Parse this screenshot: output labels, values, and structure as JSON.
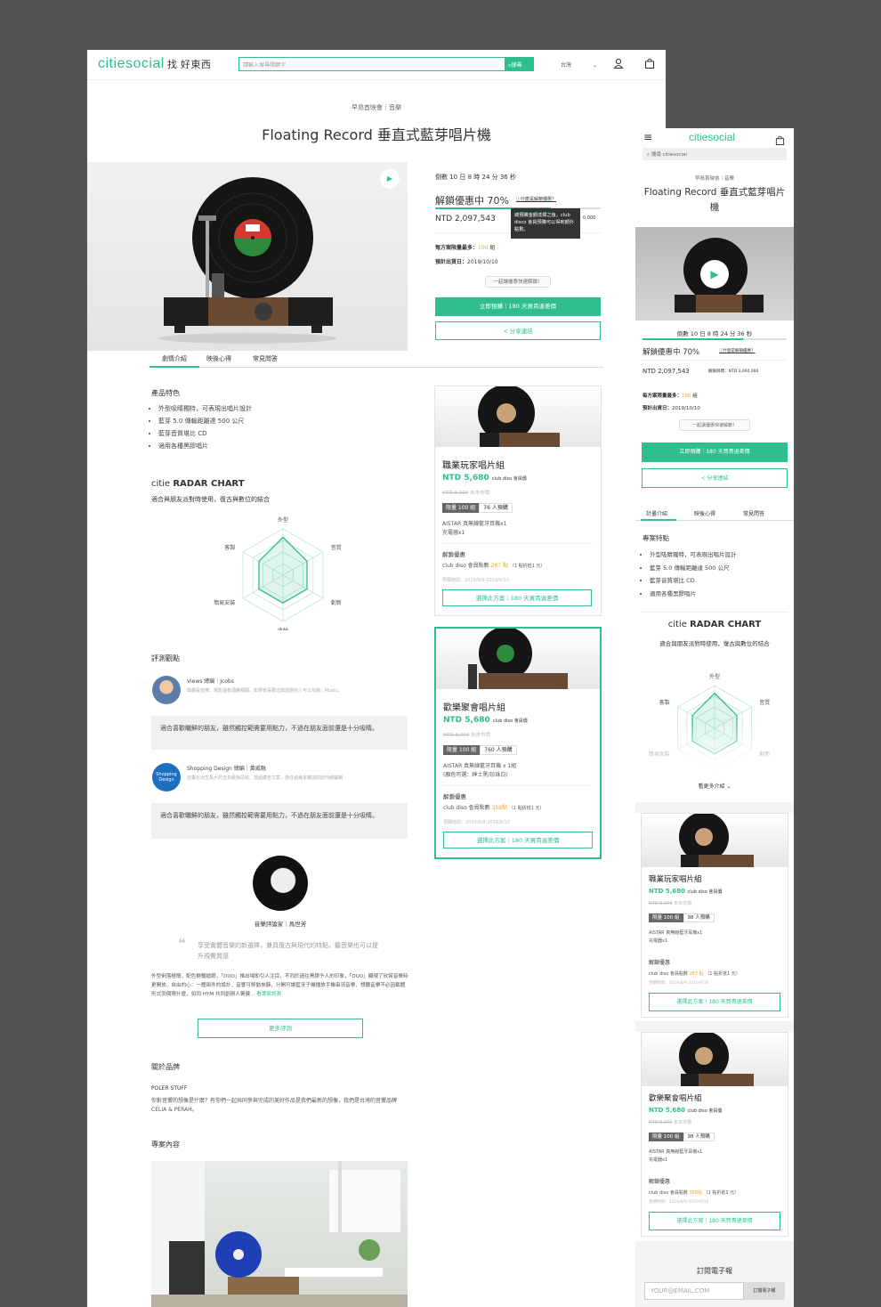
{
  "brand": {
    "name": "citiesocial",
    "slogan": "找 好東西",
    "color": "#2fbf8e"
  },
  "header": {
    "search_placeholder": "請輸入搜尋關鍵字",
    "search_button": "搜尋",
    "region": "台灣"
  },
  "project": {
    "category": "早鳥首映會｜音樂",
    "title": "Floating Record 垂直式藍芽唱片機",
    "countdown": "倒數 10 日 8 時 24 分 36 秒",
    "unlock": "解鎖優惠中 70%",
    "what_unlock": "什麼是解鎖優惠？",
    "amount": "NTD 2,097,543",
    "goal": "解鎖目標：NTD 3,000,000",
    "goal_short": "0,000",
    "tooltip": "總預購金額達標之後，club disco 會員預購可以得到額外點數。",
    "limit_label": "每方案限量最多：",
    "limit_value": "100",
    "limit_unit": "組",
    "ship_label": "預計出貨日：",
    "ship_value": "2019/10/10",
    "hint": "一起讓優惠快速解鎖！",
    "preorder_button": "立即預購｜180 天買貴退差價",
    "share_button": "分享連結",
    "progress": 0.7
  },
  "tabs": [
    "劇情介紹",
    "映後心得",
    "常見問答"
  ],
  "mobile_tabs": [
    "計畫介紹",
    "映後心得",
    "常見問答"
  ],
  "features": {
    "title": "產品特色",
    "mobile_title": "專案特點",
    "items": [
      "外型吸睛獨特，可表現出唱片設計",
      "藍芽 5.0 傳輸距離達 500 公尺",
      "藍芽音質堪比 CD",
      "適用各種黑膠唱片"
    ]
  },
  "radar": {
    "title_light": "citie",
    "title_bold": "RADAR CHART",
    "subtitle": "適合與朋友派對時使用，復古與數位的結合",
    "axes": [
      "外型",
      "音質",
      "創新",
      "收納",
      "簡易安裝",
      "客製"
    ],
    "values": [
      0.82,
      0.6,
      0.6,
      0.6,
      0.6,
      0.6
    ],
    "more": "看更多介紹"
  },
  "reviews": {
    "title": "評測觀點",
    "items": [
      {
        "name": "Views 總編｜Jcobs",
        "desc": "興趣是音樂、電影還有酒精相關，如果有喜歡這篇話題的人可以找我，Music。",
        "text": "適合喜歡曬鮮的朋友，雖然觸控範需要用點力，不過在朋友面前還是十分吸睛。"
      },
      {
        "name": "Shopping Design 總編｜黃威融",
        "desc": "在臺北出生長大的五年級後段班，當過廣告文案，擔任過幾本雜誌的創刊總編輯",
        "avatar_text": "Shopping Design",
        "text": "適合喜歡曬鮮的朋友，雖然觸控範需要用點力，不過在朋友面前還是十分吸睛。"
      }
    ]
  },
  "critic": {
    "name": "音樂評論家｜馬世芳",
    "quote": "享受實體音樂的新選擇，兼具復古與現代的特點，聽音樂也可以提升視覺質感",
    "body": "外型俐落極簡，配色鮮豔搶眼，「DUO」推出場即引人注目，不同於過往黑膠予人的印象，「DUO」顯現了欣賞音樂時更開放、自由的心：一體兩件的設計，音響可移動來靜，分開可讓藍牙子機播放手機串流音樂，想聽音樂不必因載體形式而侷限什麼，如同 HYM 共同創辦人黃健...",
    "more_link": "看專家評測",
    "more_button": "更多評測"
  },
  "brand_section": {
    "title": "關於品牌",
    "name": "POLER STUFF",
    "text": "你對音響的想像是什麼？有你們一起共同參與完成的美好作品是我們最新的想像，我們是台灣的音響品牌CELIA & PERAH。"
  },
  "content_title": "專案內容",
  "plans": [
    {
      "name": "職業玩家唱片組",
      "price": "NTD 5,680",
      "price_note": "club diso 會員價",
      "orig": "NTD 8,000",
      "orig_note": "未來市價",
      "limit": "限量 100 組",
      "sold": "76 人預購",
      "mobile_sold": "98 人預購",
      "items": [
        "AISTAR 真無線藍牙耳機x1",
        "充電器x1"
      ],
      "unlock_title": "解鎖優惠",
      "unlock_text": "club diso 會員點數",
      "points": "267 點",
      "points_note": "（1 點折抵1 元）",
      "period": "預購時間：2019/8/9-2019/9/10",
      "button": "選擇此方案｜180 天買貴退差價"
    },
    {
      "name": "歡樂聚會唱片組",
      "price": "NTD 5,680",
      "price_note": "club diso 會員價",
      "orig": "NTD 8,000",
      "orig_note": "未來市價",
      "limit": "限量 100 組",
      "sold": "760 人預購",
      "mobile_sold": "98 人預購",
      "items": [
        "AISTAR 真無線藍牙耳機 x 1組",
        "(顏色可選：紳士黑/珍珠白)"
      ],
      "mobile_items": [
        "AISTAR 真無線藍牙耳機x1",
        "充電器x1"
      ],
      "unlock_title": "解鎖優惠",
      "unlock_text": "club diso 會員點數",
      "points": "358點",
      "points_note": "（1 點折抵1 元）",
      "period": "預購時間：2019/8/9-2019/9/10",
      "button": "選擇此方案｜180 天買貴退差價"
    }
  ],
  "mobile": {
    "search_placeholder": "搜尋 citiesocial",
    "title": "Floating Record 垂直式藍芽唱片機",
    "newsletter": "訂閱電子報",
    "email_placeholder": "YOUR@EMAIL.COM",
    "subscribe": "訂閱電子報"
  }
}
